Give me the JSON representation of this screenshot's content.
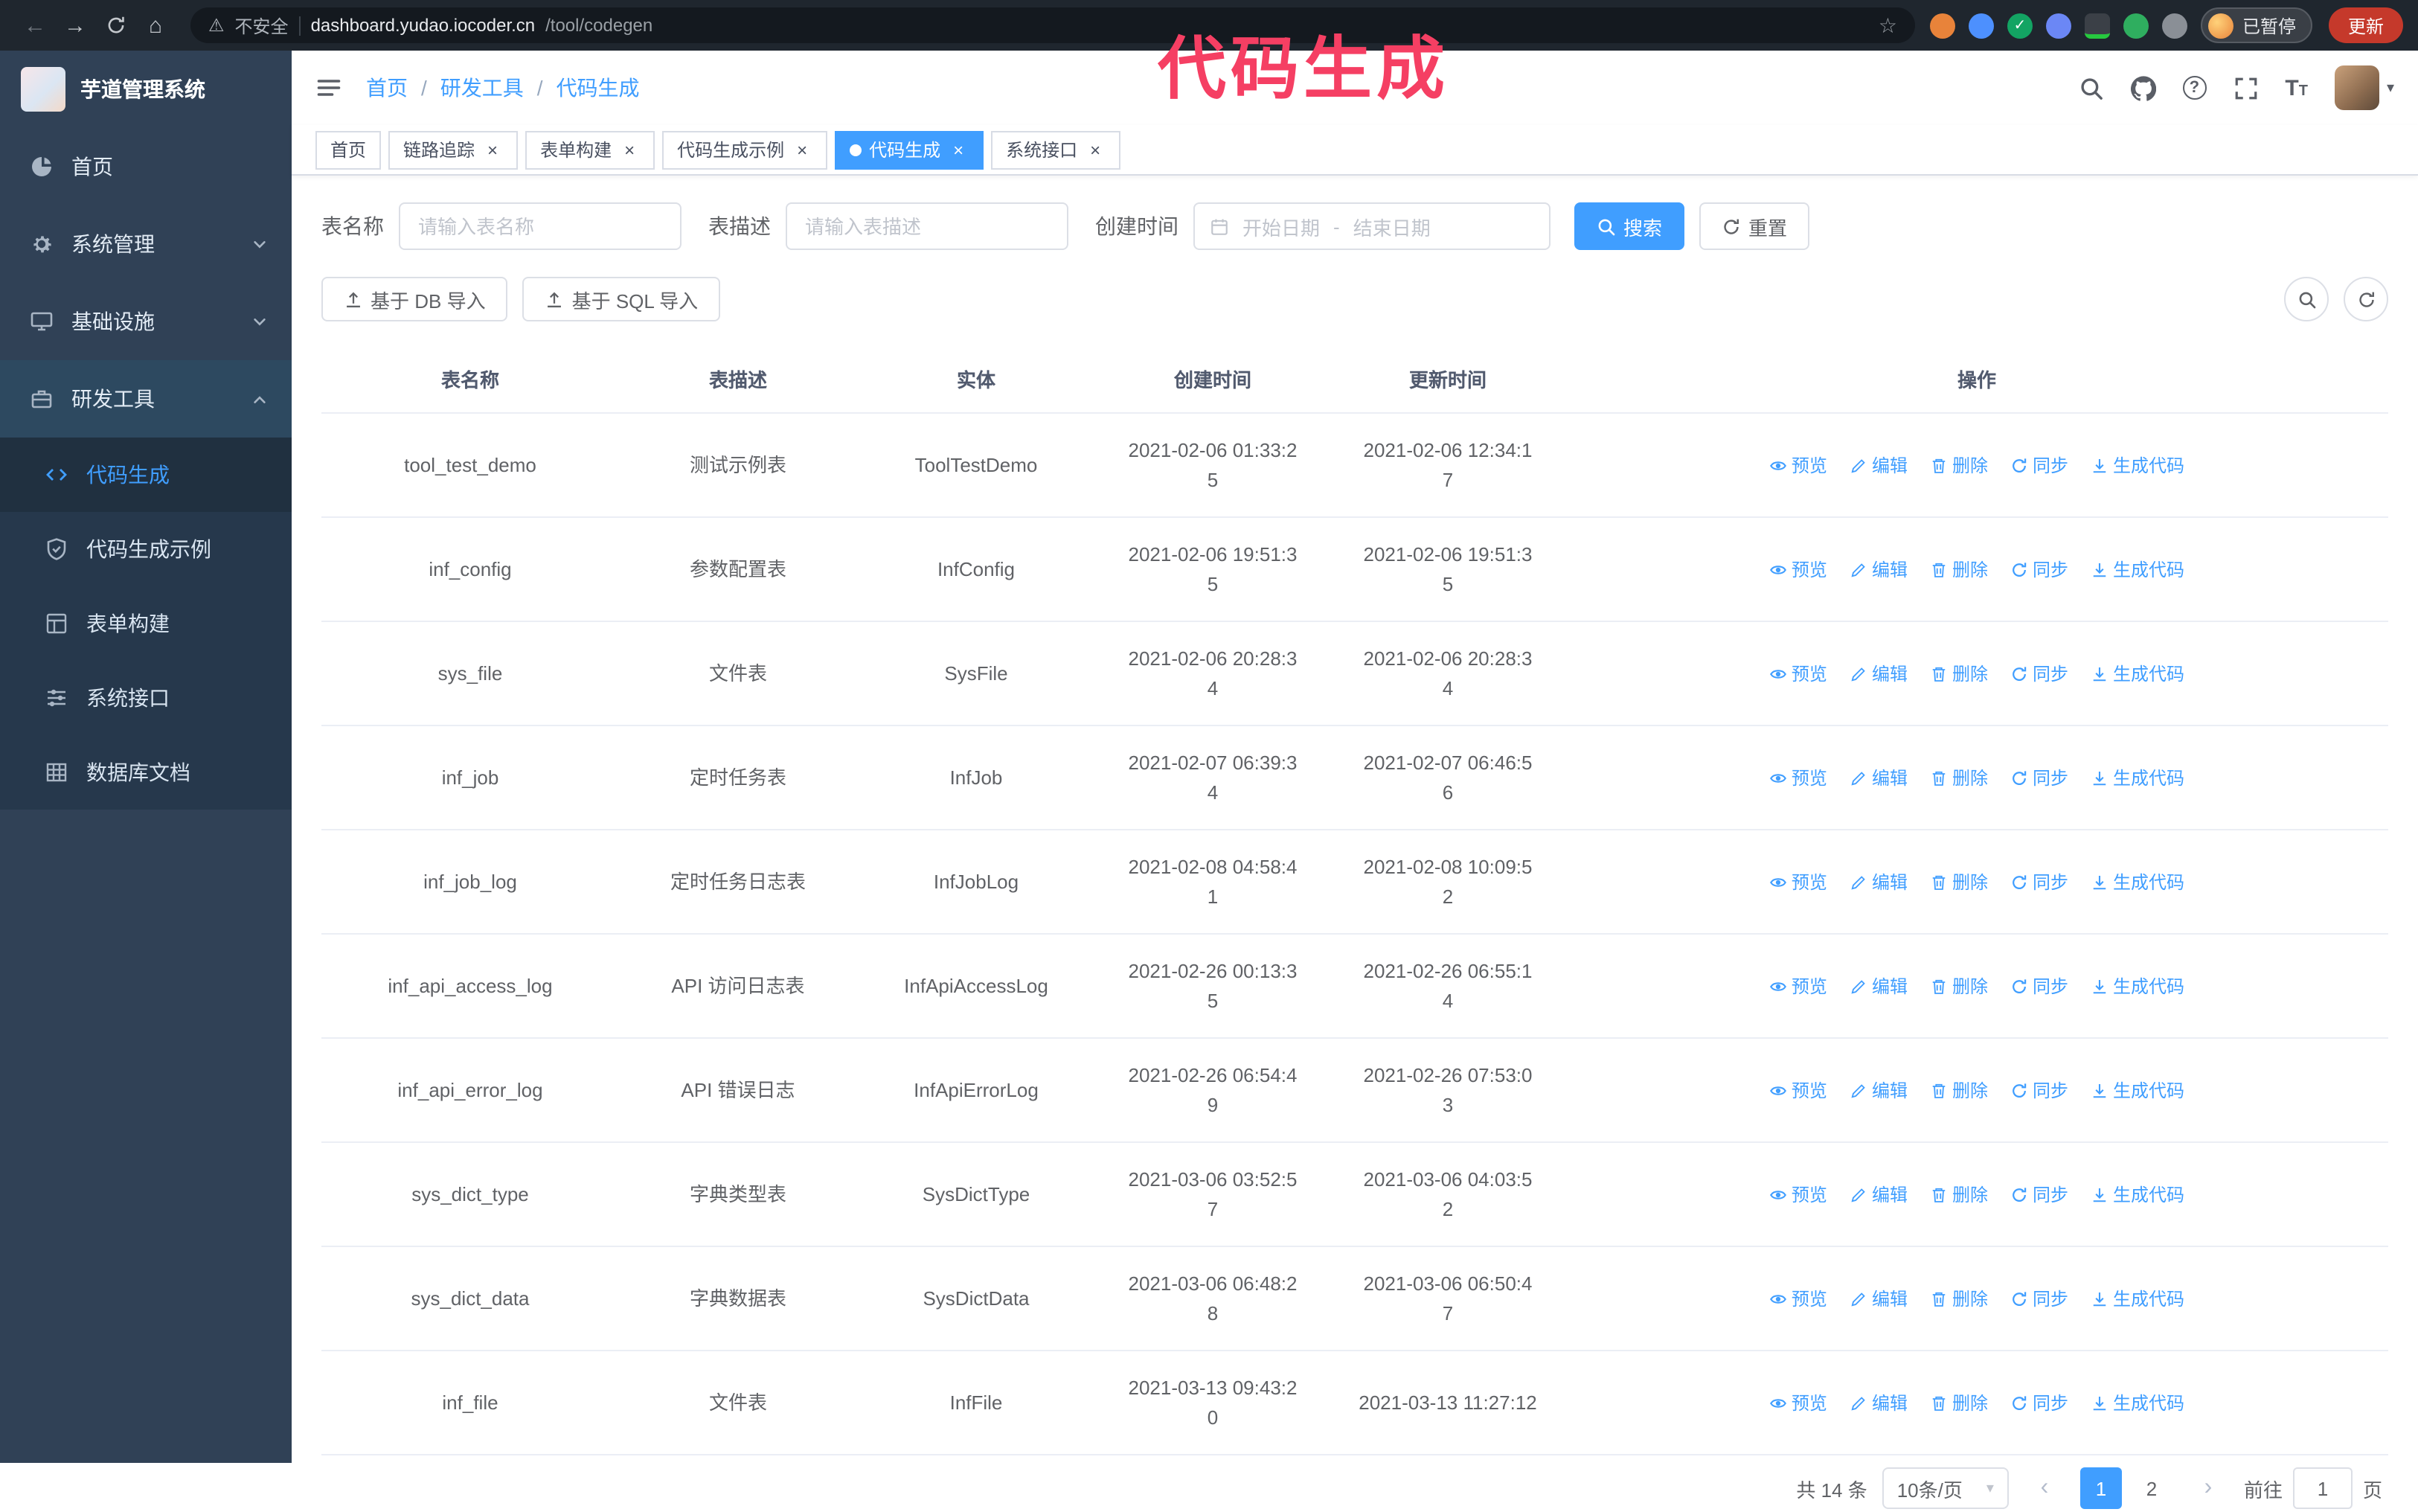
{
  "colors": {
    "accent": "#409eff",
    "annotation": "#f53f63",
    "sidebar_bg": "#304156"
  },
  "browser": {
    "not_secure": "不安全",
    "url_host": "dashboard.yudao.iocoder.cn",
    "url_path": "/tool/codegen",
    "paused_badge": "已暂停",
    "update_button": "更新"
  },
  "annotation": {
    "text": "代码生成"
  },
  "sidebar": {
    "logo_title": "芋道管理系统",
    "items": [
      {
        "label": "首页",
        "expandable": false,
        "expanded": false
      },
      {
        "label": "系统管理",
        "expandable": true,
        "expanded": false
      },
      {
        "label": "基础设施",
        "expandable": true,
        "expanded": false
      },
      {
        "label": "研发工具",
        "expandable": true,
        "expanded": true
      }
    ],
    "submenu": [
      {
        "label": "代码生成",
        "active": true
      },
      {
        "label": "代码生成示例",
        "active": false
      },
      {
        "label": "表单构建",
        "active": false
      },
      {
        "label": "系统接口",
        "active": false
      },
      {
        "label": "数据库文档",
        "active": false
      }
    ]
  },
  "header": {
    "breadcrumb": [
      "首页",
      "研发工具",
      "代码生成"
    ]
  },
  "tags": [
    {
      "label": "首页",
      "closable": false,
      "active": false
    },
    {
      "label": "链路追踪",
      "closable": true,
      "active": false
    },
    {
      "label": "表单构建",
      "closable": true,
      "active": false
    },
    {
      "label": "代码生成示例",
      "closable": true,
      "active": false
    },
    {
      "label": "代码生成",
      "closable": true,
      "active": true
    },
    {
      "label": "系统接口",
      "closable": true,
      "active": false
    }
  ],
  "filters": {
    "name_label": "表名称",
    "name_placeholder": "请输入表名称",
    "desc_label": "表描述",
    "desc_placeholder": "请输入表描述",
    "time_label": "创建时间",
    "start_placeholder": "开始日期",
    "range_separator": "-",
    "end_placeholder": "结束日期",
    "search_button": "搜索",
    "reset_button": "重置"
  },
  "toolbar": {
    "import_db": "基于 DB 导入",
    "import_sql": "基于 SQL 导入"
  },
  "table": {
    "columns": [
      "表名称",
      "表描述",
      "实体",
      "创建时间",
      "更新时间",
      "操作"
    ],
    "actions": [
      "预览",
      "编辑",
      "删除",
      "同步",
      "生成代码"
    ],
    "rows": [
      {
        "name": "tool_test_demo",
        "desc": "测试示例表",
        "entity": "ToolTestDemo",
        "created": "2021-02-06 01:33:25",
        "updated": "2021-02-06 12:34:17"
      },
      {
        "name": "inf_config",
        "desc": "参数配置表",
        "entity": "InfConfig",
        "created": "2021-02-06 19:51:35",
        "updated": "2021-02-06 19:51:35"
      },
      {
        "name": "sys_file",
        "desc": "文件表",
        "entity": "SysFile",
        "created": "2021-02-06 20:28:34",
        "updated": "2021-02-06 20:28:34"
      },
      {
        "name": "inf_job",
        "desc": "定时任务表",
        "entity": "InfJob",
        "created": "2021-02-07 06:39:34",
        "updated": "2021-02-07 06:46:56"
      },
      {
        "name": "inf_job_log",
        "desc": "定时任务日志表",
        "entity": "InfJobLog",
        "created": "2021-02-08 04:58:41",
        "updated": "2021-02-08 10:09:52"
      },
      {
        "name": "inf_api_access_log",
        "desc": "API 访问日志表",
        "entity": "InfApiAccessLog",
        "created": "2021-02-26 00:13:35",
        "updated": "2021-02-26 06:55:14"
      },
      {
        "name": "inf_api_error_log",
        "desc": "API 错误日志",
        "entity": "InfApiErrorLog",
        "created": "2021-02-26 06:54:49",
        "updated": "2021-02-26 07:53:03"
      },
      {
        "name": "sys_dict_type",
        "desc": "字典类型表",
        "entity": "SysDictType",
        "created": "2021-03-06 03:52:57",
        "updated": "2021-03-06 04:03:52"
      },
      {
        "name": "sys_dict_data",
        "desc": "字典数据表",
        "entity": "SysDictData",
        "created": "2021-03-06 06:48:28",
        "updated": "2021-03-06 06:50:47"
      },
      {
        "name": "inf_file",
        "desc": "文件表",
        "entity": "InfFile",
        "created": "2021-03-13 09:43:20",
        "updated": "2021-03-13 11:27:12"
      }
    ]
  },
  "pagination": {
    "total": "共 14 条",
    "page_size": "10条/页",
    "pages": [
      "1",
      "2"
    ],
    "active_page": "1",
    "goto_label": "前往",
    "goto_value": "1",
    "page_label": "页"
  }
}
